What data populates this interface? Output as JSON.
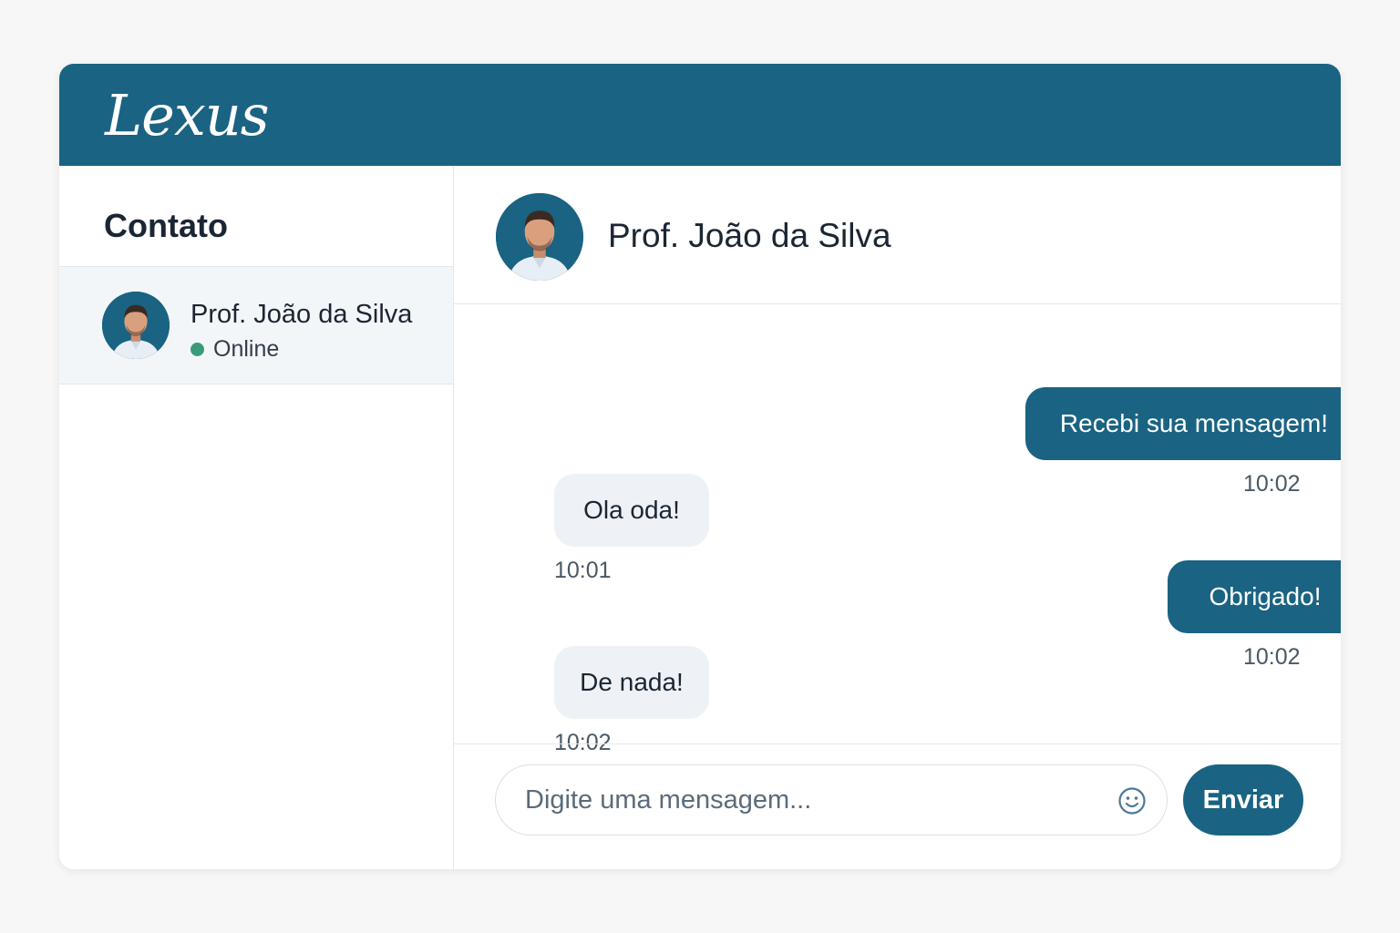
{
  "app": {
    "brand": "Lexus"
  },
  "sidebar": {
    "title": "Contato",
    "contacts": [
      {
        "name": "Prof. João da Silva",
        "status": "Online",
        "avatar_icon": "person-avatar"
      }
    ]
  },
  "chat": {
    "header": {
      "name": "Prof. João da Silva"
    },
    "messages": [
      {
        "direction": "out",
        "text": "Recebi sua mensagem!",
        "time": "10:02"
      },
      {
        "direction": "in",
        "text": "Ola oda!",
        "time": "10:01"
      },
      {
        "direction": "out",
        "text": "Obrigado!",
        "time": "10:02"
      },
      {
        "direction": "in",
        "text": "De nada!",
        "time": "10:02"
      }
    ],
    "composer": {
      "placeholder": "Digite uma mensagem...",
      "value": "",
      "emoji_icon": "smiley-icon",
      "send_label": "Enviar"
    }
  },
  "colors": {
    "primary": "#1a6382",
    "incoming_bubble": "#eef2f6",
    "online": "#3a9b7a",
    "background": "#f7f7f7"
  }
}
